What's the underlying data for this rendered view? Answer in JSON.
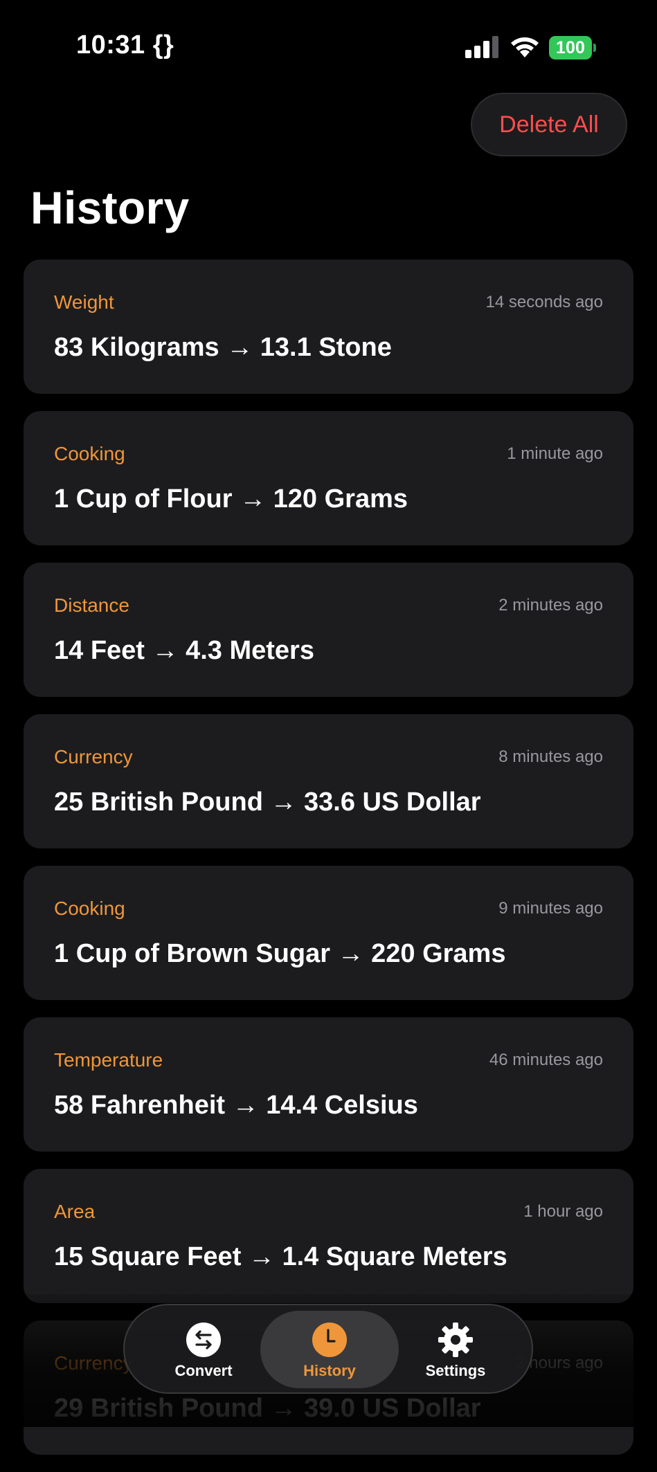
{
  "status_bar": {
    "time": "10:31 {}",
    "battery": "100"
  },
  "header": {
    "delete_all_label": "Delete All",
    "title": "History"
  },
  "history": [
    {
      "category": "Weight",
      "time": "14 seconds ago",
      "result": "83 Kilograms → 13.1 Stone"
    },
    {
      "category": "Cooking",
      "time": "1 minute ago",
      "result": "1 Cup of Flour → 120 Grams"
    },
    {
      "category": "Distance",
      "time": "2 minutes ago",
      "result": "14 Feet → 4.3 Meters"
    },
    {
      "category": "Currency",
      "time": "8 minutes ago",
      "result": "25 British Pound → 33.6 US Dollar"
    },
    {
      "category": "Cooking",
      "time": "9 minutes ago",
      "result": "1 Cup of Brown Sugar → 220 Grams"
    },
    {
      "category": "Temperature",
      "time": "46 minutes ago",
      "result": "58 Fahrenheit → 14.4 Celsius"
    },
    {
      "category": "Area",
      "time": "1 hour ago",
      "result": "15 Square Feet → 1.4 Square Meters"
    },
    {
      "category": "Currency",
      "time": "2 hours ago",
      "result": "29 British Pound → 39.0 US Dollar"
    }
  ],
  "tab_bar": {
    "tabs": [
      {
        "label": "Convert",
        "icon": "convert-arrows-icon"
      },
      {
        "label": "History",
        "icon": "clock-icon"
      },
      {
        "label": "Settings",
        "icon": "gear-icon"
      }
    ],
    "active": "History"
  },
  "colors": {
    "background": "#000000",
    "card": "#1c1c1e",
    "accent_orange": "#f0963a",
    "delete_red": "#ff4d4d",
    "battery_green": "#33c759",
    "secondary_text": "#98989e"
  }
}
